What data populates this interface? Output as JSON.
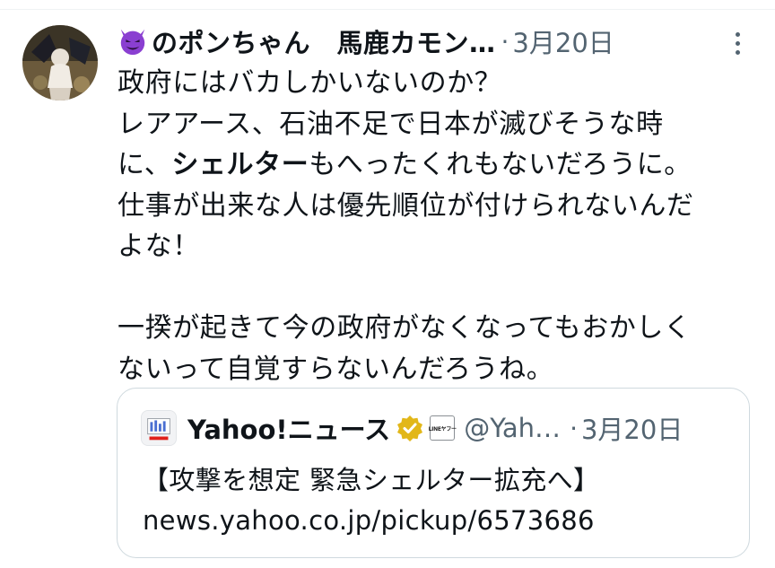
{
  "tweet": {
    "display_name": "のポンちゃん　馬鹿カモン…",
    "dot": "·",
    "timestamp": "3月20日",
    "body_lines": {
      "l1": "政府にはバカしかいないのか？",
      "l2": "レアアース、石油不足で日本が滅びそうな時",
      "l3_pre": "に、",
      "l3_bold": "シェルター",
      "l3_post": "もへったくれもないだろうに。",
      "l4": "仕事が出来な人は優先順位が付けられないんだ",
      "l5": "よな！",
      "l6": "",
      "l7": "一揆が起きて今の政府がなくなってもおかしく",
      "l8": "ないって自覚すらないんだろうね。"
    }
  },
  "quote": {
    "name": "Yahoo!ニュース",
    "badge_text": "LINEヤフー",
    "handle": "@Yah…",
    "dot": "·",
    "timestamp": "3月20日",
    "text": "【攻撃を想定 緊急シェルター拡充へ】",
    "link": "news.yahoo.co.jp/pickup/6573686"
  },
  "colors": {
    "text": "#0f1419",
    "secondary": "#536471",
    "border": "#cfd9de",
    "verified_gold": "#e2b719",
    "devil_purple": "#8a3fd1"
  },
  "icons": {
    "name_emoji": "smiling-devil-icon",
    "more": "more-vertical-icon",
    "verified": "gold-verified-badge-icon"
  }
}
